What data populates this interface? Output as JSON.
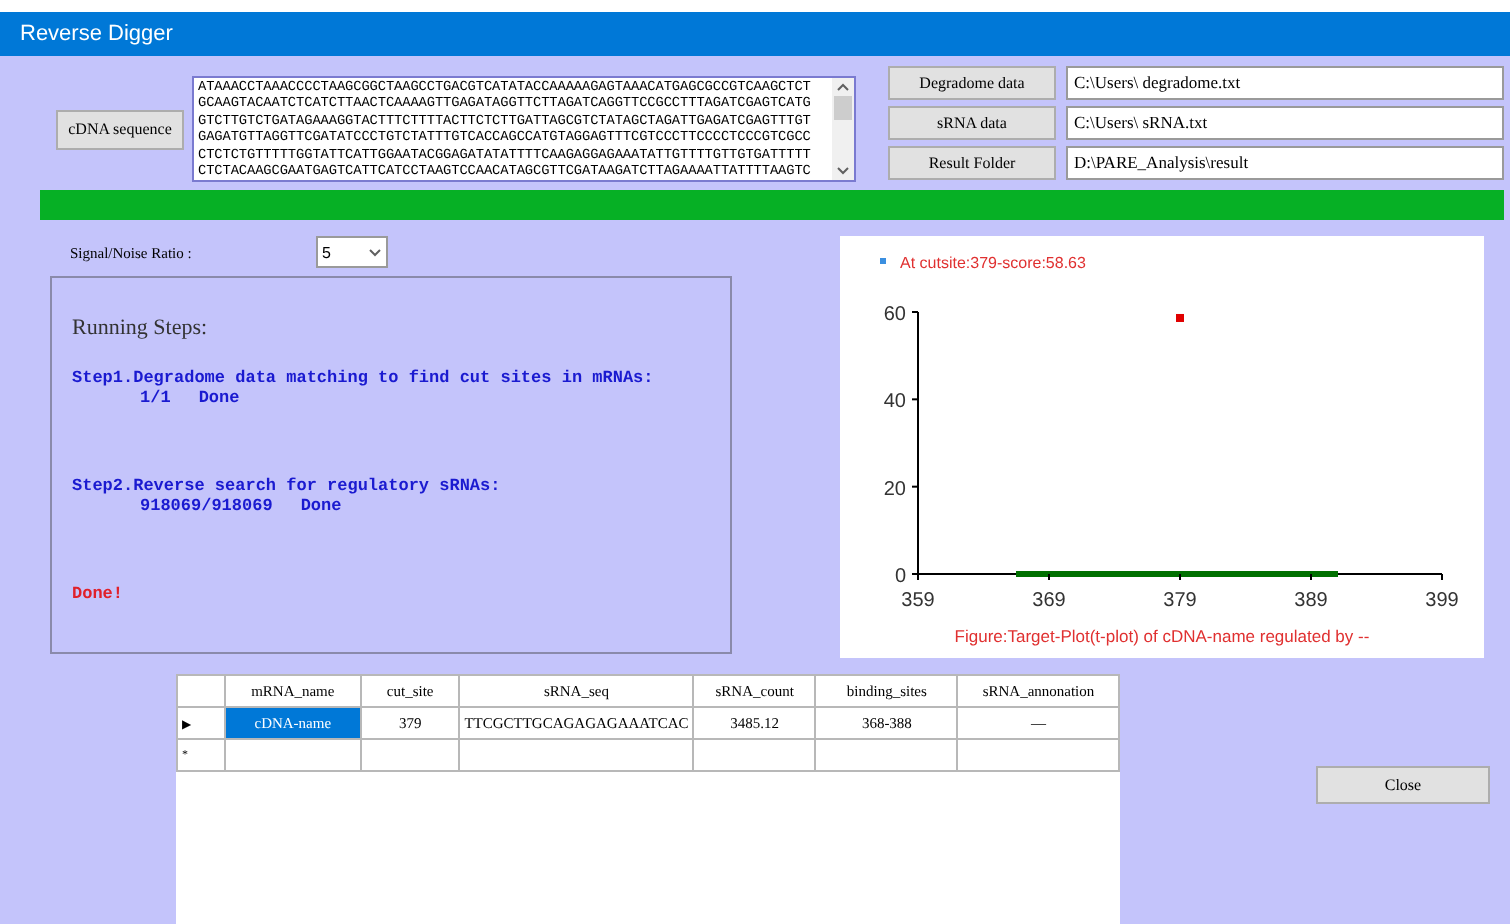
{
  "window": {
    "title": "Reverse Digger"
  },
  "inputs": {
    "cdna_button": "cDNA sequence",
    "sequence_lines": [
      "ATAAACCTAAACCCCTAAGCGGCTAAGCCTGACGTCATATACCAAAAAGAGTAAACATGAGCGCCGTCAAGCTCT",
      "GCAAGTACAATCTCATCTTAACTCAAAAGTTGAGATAGGTTCTTAGATCAGGTTCCGCCTTTAGATCGAGTCATG",
      "GTCTTGTCTGATAGAAAGGTACTTTCTTTTACTTCTCTTGATTAGCGTCTATAGCTAGATTGAGATCGAGTTTGT",
      "GAGATGTTAGGTTCGATATCCCTGTCTATTTGTCACCAGCCATGTAGGAGTTTCGTCCCTTCCCCTCCCGTCGCC",
      "CTCTCTGTTTTTGGTATTCATTGGAATACGGAGATATATTTTCAAGAGGAGAAATATTGTTTTGTTGTGATTTTT",
      "CTCTACAAGCGAATGAGTCATTCATCCTAAGTCCAACATAGCGTTCGATAAGATCTTAGAAAATTATTTTAAGTC"
    ],
    "files": [
      {
        "button": "Degradome data",
        "value": "C:\\Users\\ degradome.txt"
      },
      {
        "button": "sRNA data",
        "value": "C:\\Users\\ sRNA.txt"
      },
      {
        "button": "Result Folder",
        "value": "D:\\PARE_Analysis\\result"
      }
    ]
  },
  "progress": {
    "level": 1
  },
  "ratio": {
    "label": "Signal/Noise Ratio :",
    "value": "5"
  },
  "log": {
    "heading": "Running Steps:",
    "steps": [
      {
        "title": "Step1.Degradome data matching to find cut sites in mRNAs:",
        "count": "1/1",
        "status": "Done"
      },
      {
        "title": "Step2.Reverse search for regulatory sRNAs:",
        "count": "918069/918069",
        "status": "Done"
      }
    ],
    "final": "Done!"
  },
  "plot": {
    "chart_data": {
      "type": "scatter",
      "title": "Figure:Target-Plot(t-plot) of cDNA-name regulated by --",
      "x": [
        379
      ],
      "series": [
        {
          "name": "At cutsite:379-score:58.63",
          "color": "#e00000",
          "values": [
            58.63
          ]
        }
      ],
      "xlim": [
        359,
        399
      ],
      "ylim": [
        0,
        60
      ],
      "xticks": [
        359,
        369,
        379,
        389,
        399
      ],
      "yticks": [
        0,
        20,
        40,
        60
      ]
    }
  },
  "table": {
    "columns": [
      "mRNA_name",
      "cut_site",
      "sRNA_seq",
      "sRNA_count",
      "binding_sites",
      "sRNA_annonation"
    ],
    "rows": [
      {
        "marker": "▶",
        "cells": [
          {
            "text": "cDNA-name",
            "selected": true
          },
          {
            "text": "379",
            "selected": false
          },
          {
            "text": "TTCGCTTGCAGAGAGAAATCAC",
            "selected": false
          },
          {
            "text": "3485.12",
            "selected": false
          },
          {
            "text": "368-388",
            "selected": false
          },
          {
            "text": "—",
            "selected": false
          }
        ]
      }
    ],
    "new_row": {
      "marker": "*"
    }
  },
  "buttons": {
    "close": "Close"
  }
}
